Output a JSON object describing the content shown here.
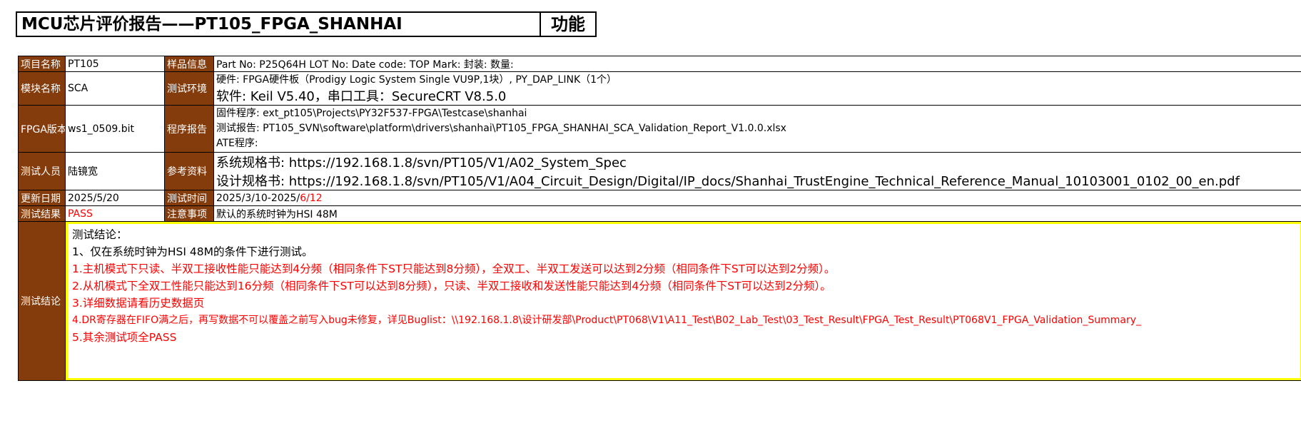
{
  "header": {
    "title": "MCU芯片评价报告——PT105_FPGA_SHANHAI",
    "category": "功能"
  },
  "rows": {
    "project": {
      "label": "项目名称",
      "value": "PT105"
    },
    "sample": {
      "label": "样品信息",
      "value": "Part No: P25Q64H   LOT No:    Date code:    TOP Mark:        封装:    数量:"
    },
    "module": {
      "label": "模块名称",
      "value": "SCA"
    },
    "env": {
      "label": "测试环境",
      "hw": "硬件: FPGA硬件板（Prodigy Logic System Single VU9P,1块）, PY_DAP_LINK（1个）",
      "sw": "软件: Keil V5.40，串口工具：SecureCRT V8.5.0"
    },
    "fpga": {
      "label": "FPGA版本",
      "value": "ws1_0509.bit"
    },
    "program": {
      "label": "程序报告",
      "firmware": "固件程序: ext_pt105\\Projects\\PY32F537-FPGA\\Testcase\\shanhai",
      "report": "测试报告:  PT105_SVN\\software\\platform\\drivers\\shanhai\\PT105_FPGA_SHANHAI_SCA_Validation_Report_V1.0.0.xlsx",
      "ate": "ATE程序:"
    },
    "tester": {
      "label": "测试人员",
      "value": "陆镜宽"
    },
    "reference": {
      "label": "参考资料",
      "sys_spec": "系统规格书: https://192.168.1.8/svn/PT105/V1/A02_System_Spec",
      "design_spec": "设计规格书: https://192.168.1.8/svn/PT105/V1/A04_Circuit_Design/Digital/IP_docs/Shanhai_TrustEngine_Technical_Reference_Manual_10103001_0102_00_en.pdf"
    },
    "update_date": {
      "label": "更新日期",
      "value": "2025/5/20"
    },
    "test_time": {
      "label": "测试时间",
      "value_black": "2025/3/10-2025/",
      "value_red": "6/12"
    },
    "result": {
      "label": "测试结果",
      "value": "PASS"
    },
    "notes": {
      "label": "注意事项",
      "value": "默认的系统时钟为HSI 48M"
    },
    "conclusion": {
      "label": "测试结论",
      "lines": [
        "测试结论：",
        "1、仅在系统时钟为HSI 48M的条件下进行测试。",
        "1.主机模式下只读、半双工接收性能只能达到4分频（相同条件下ST只能达到8分频），全双工、半双工发送可以达到2分频（相同条件下ST可以达到2分频）。",
        "2.从机模式下全双工性能只能达到16分频（相同条件下ST可以达到8分频），只读、半双工接收和发送性能只能达到4分频（相同条件下ST可以达到2分频）。",
        "3.详细数据请看历史数据页",
        "4.DR寄存器在FIFO满之后，再写数据不可以覆盖之前写入bug未修复，详见Buglist：\\\\192.168.1.8\\设计研发部\\Product\\PT068\\V1\\A11_Test\\B02_Lab_Test\\03_Test_Result\\FPGA_Test_Result\\PT068V1_FPGA_Validation_Summary_",
        "5.其余测试项全PASS"
      ]
    }
  },
  "colors": {
    "label_bg": "#843c0c",
    "highlight": "#ff0000",
    "box_border": "#ffff00"
  }
}
